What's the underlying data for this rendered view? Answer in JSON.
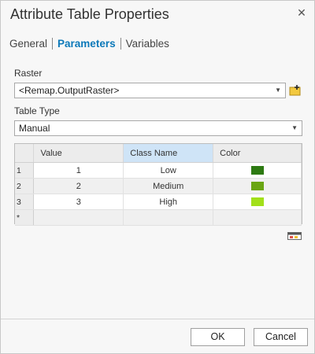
{
  "window": {
    "title": "Attribute Table Properties"
  },
  "tabs": [
    {
      "label": "General",
      "active": false
    },
    {
      "label": "Parameters",
      "active": true
    },
    {
      "label": "Variables",
      "active": false
    }
  ],
  "raster": {
    "label": "Raster",
    "value": "<Remap.OutputRaster>"
  },
  "table_type": {
    "label": "Table Type",
    "value": "Manual"
  },
  "grid": {
    "columns": [
      "Value",
      "Class Name",
      "Color"
    ],
    "rows": [
      {
        "num": "1",
        "value": "1",
        "class_name": "Low",
        "color": "#2d7a12"
      },
      {
        "num": "2",
        "value": "2",
        "class_name": "Medium",
        "color": "#6aa514"
      },
      {
        "num": "3",
        "value": "3",
        "class_name": "High",
        "color": "#a2e01a"
      }
    ],
    "new_row_marker": "*"
  },
  "buttons": {
    "ok": "OK",
    "cancel": "Cancel"
  },
  "colors": {
    "accent": "#0d79b9",
    "selected_header": "#cfe4f7"
  }
}
